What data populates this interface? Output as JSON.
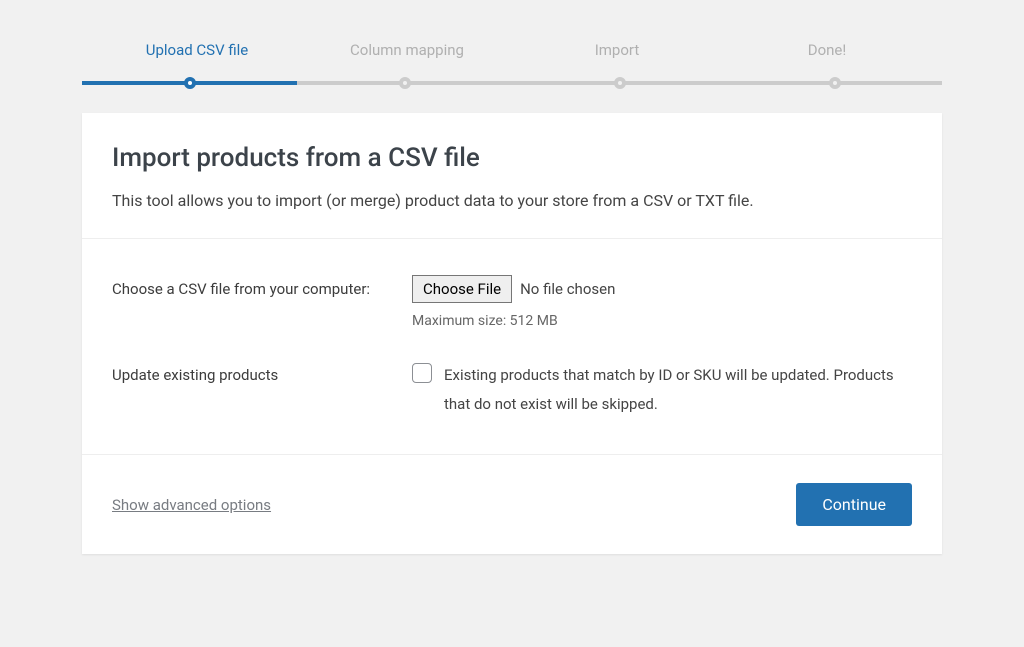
{
  "stepper": {
    "steps": [
      {
        "label": "Upload CSV file",
        "active": true
      },
      {
        "label": "Column mapping",
        "active": false
      },
      {
        "label": "Import",
        "active": false
      },
      {
        "label": "Done!",
        "active": false
      }
    ]
  },
  "header": {
    "title": "Import products from a CSV file",
    "description": "This tool allows you to import (or merge) product data to your store from a CSV or TXT file."
  },
  "form": {
    "file": {
      "label": "Choose a CSV file from your computer:",
      "button": "Choose File",
      "status": "No file chosen",
      "hint": "Maximum size: 512 MB"
    },
    "update": {
      "label": "Update existing products",
      "description": "Existing products that match by ID or SKU will be updated. Products that do not exist will be skipped."
    }
  },
  "footer": {
    "advanced": "Show advanced options",
    "continue": "Continue"
  }
}
